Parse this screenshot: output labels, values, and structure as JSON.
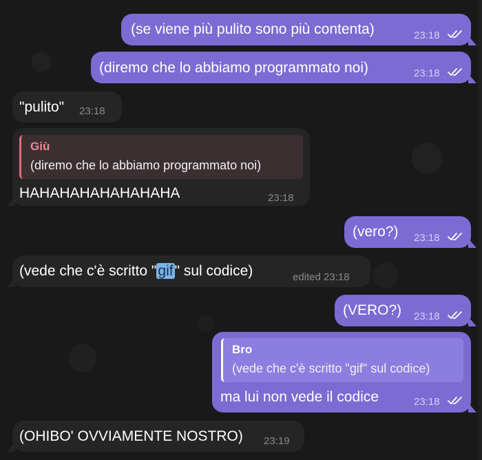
{
  "colors": {
    "background": "#191919",
    "outgoing_bubble": "#7b6bd3",
    "incoming_bubble": "#252525",
    "reply_accent": "#e06e77",
    "highlight": "#7cb4e6"
  },
  "messages": [
    {
      "text": "(se viene più pulito sono più contenta)",
      "time": "23:18",
      "status": "double-check-icon"
    },
    {
      "text": "(diremo che lo abbiamo programmato noi)",
      "time": "23:18",
      "status": "double-check-icon"
    },
    {
      "text": "\"pulito\"",
      "time": "23:18"
    },
    {
      "reply_name": "Giù",
      "reply_text": "(diremo che lo abbiamo programmato noi)",
      "text": "HAHAHAHAHAHAHAHA",
      "time": "23:18"
    },
    {
      "text": "(vero?)",
      "time": "23:18",
      "status": "double-check-icon"
    },
    {
      "text_before": "(vede che c'è scritto \"",
      "highlight": "gif",
      "text_after": "\" sul codice)",
      "time": "edited 23:18"
    },
    {
      "text": "(VERO?)",
      "time": "23:18",
      "status": "double-check-icon"
    },
    {
      "reply_name": "Bro",
      "reply_text": "(vede che c'è scritto \"gif\" sul codice)",
      "text": "ma lui non vede il codice",
      "time": "23:18",
      "status": "double-check-icon"
    },
    {
      "text": "(OHIBO' OVVIAMENTE NOSTRO)",
      "time": "23:19"
    }
  ]
}
